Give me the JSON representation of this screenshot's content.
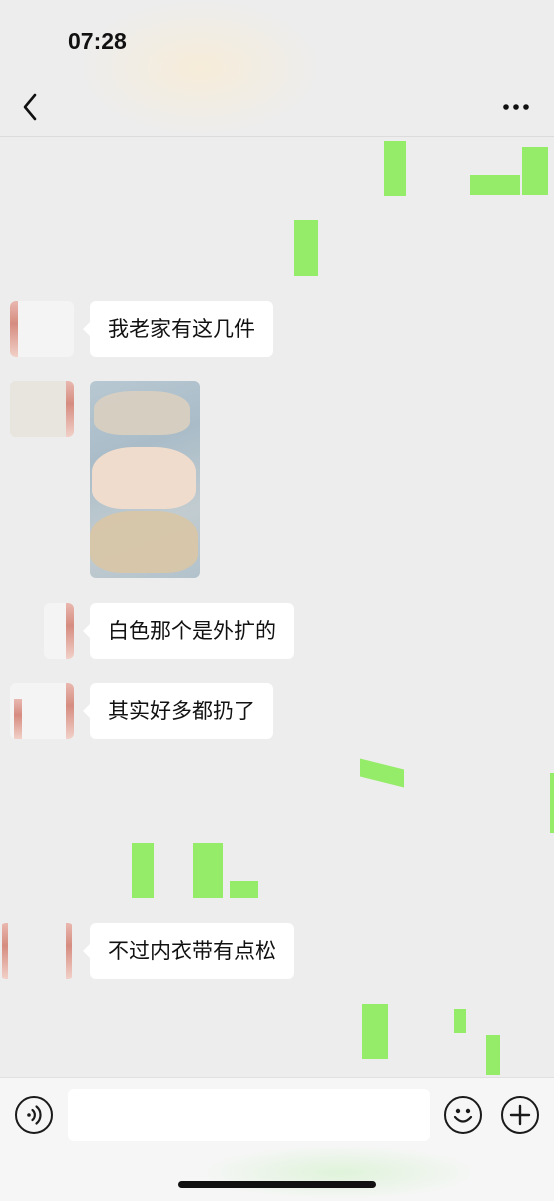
{
  "status_bar": {
    "time": "07:28"
  },
  "nav": {
    "back_icon": "chevron-left-icon",
    "more_icon": "more-dots-icon"
  },
  "messages": [
    {
      "sender": "other",
      "type": "text",
      "text": "我老家有这几件"
    },
    {
      "sender": "other",
      "type": "image",
      "description_icon": "photo"
    },
    {
      "sender": "other",
      "type": "text",
      "text": "白色那个是外扩的"
    },
    {
      "sender": "other",
      "type": "text",
      "text": "其实好多都扔了"
    },
    {
      "sender": "other",
      "type": "text",
      "text": "不过内衣带有点松"
    }
  ],
  "input_bar": {
    "voice_icon": "voice-icon",
    "emoji_icon": "emoji-icon",
    "plus_icon": "plus-icon",
    "input_value": ""
  },
  "colors": {
    "background": "#ededed",
    "bubble_other": "#ffffff",
    "bubble_self": "#95ec69",
    "text": "#111111"
  }
}
